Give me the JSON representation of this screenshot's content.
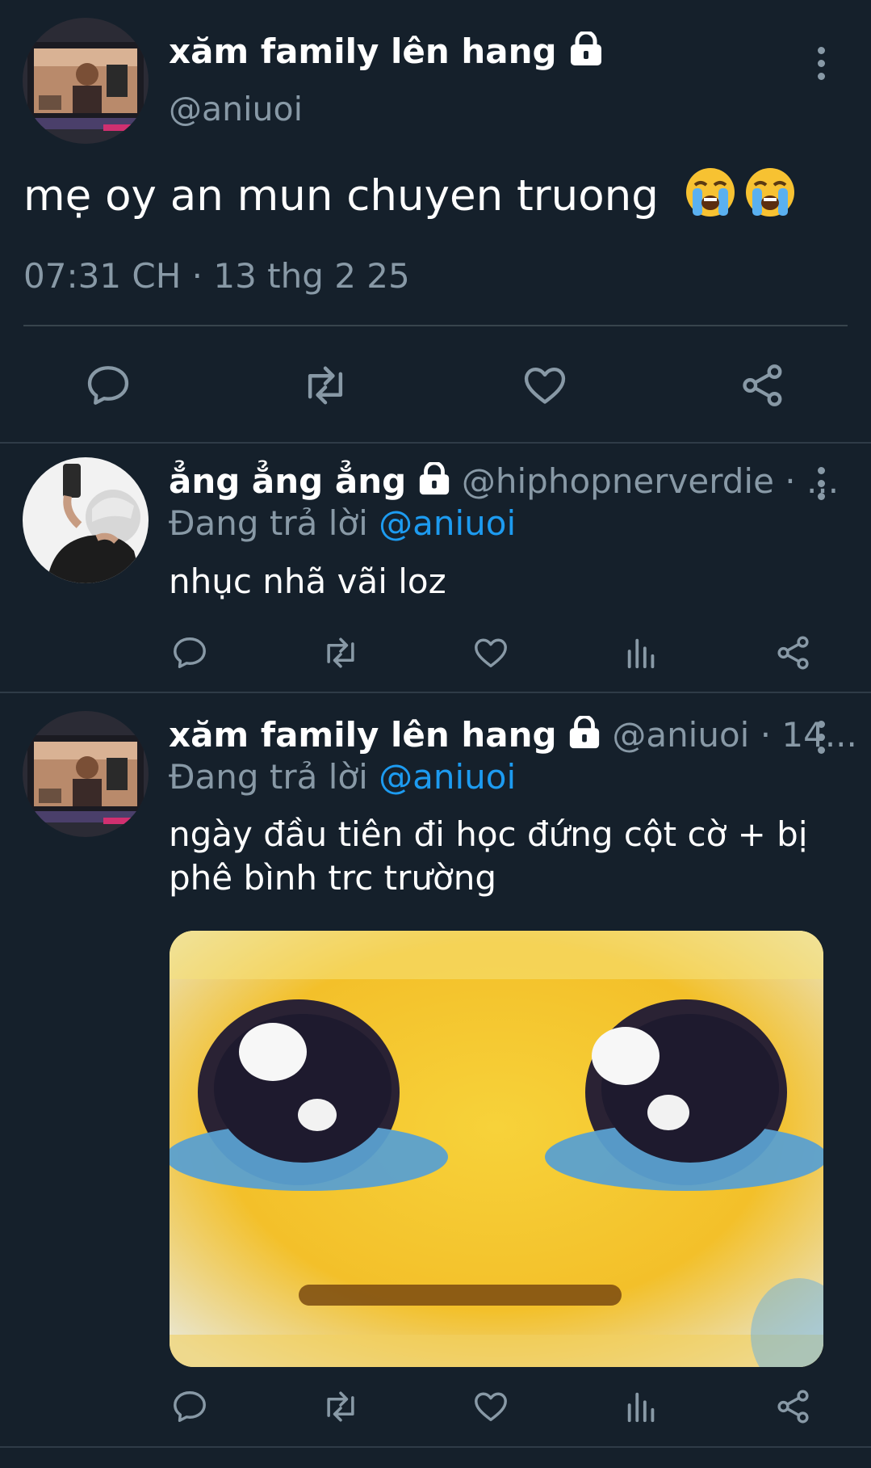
{
  "main_tweet": {
    "display_name": "xăm family lên hang",
    "handle": "@aniuoi",
    "text": "mẹ oy an mun chuyen truong",
    "emoji": "😭😭",
    "timestamp": "07:31 CH · 13 thg 2 25",
    "avatar_icon": "avatar-photo-tv",
    "lock_icon": "lock-icon",
    "actions": [
      "reply-icon",
      "retweet-icon",
      "like-icon",
      "share-icon"
    ]
  },
  "replies": [
    {
      "display_name": "ẳng ẳng ẳng",
      "handle_time": "@hiphopnerverdie · ...",
      "replying_prefix": "Đang trả lời",
      "replying_to": "@aniuoi",
      "text": "nhục nhã vãi loz",
      "avatar_icon": "avatar-photo-person",
      "actions": [
        "reply-icon",
        "retweet-icon",
        "like-icon",
        "views-icon",
        "share-icon"
      ]
    },
    {
      "display_name": "xăm family lên hang",
      "handle_time": "@aniuoi · 14...",
      "replying_prefix": "Đang trả lời",
      "replying_to": "@aniuoi",
      "text_line1": "ngày đầu tiên đi học đứng cột cờ + bị",
      "text_line2": "phê bình trc trường",
      "media_icon": "crying-face-image",
      "avatar_icon": "avatar-photo-tv",
      "actions": [
        "reply-icon",
        "retweet-icon",
        "like-icon",
        "views-icon",
        "share-icon"
      ]
    }
  ],
  "colors": {
    "background": "#15202b",
    "text": "#ffffff",
    "muted": "#8899a6",
    "link": "#1d9bf0"
  }
}
